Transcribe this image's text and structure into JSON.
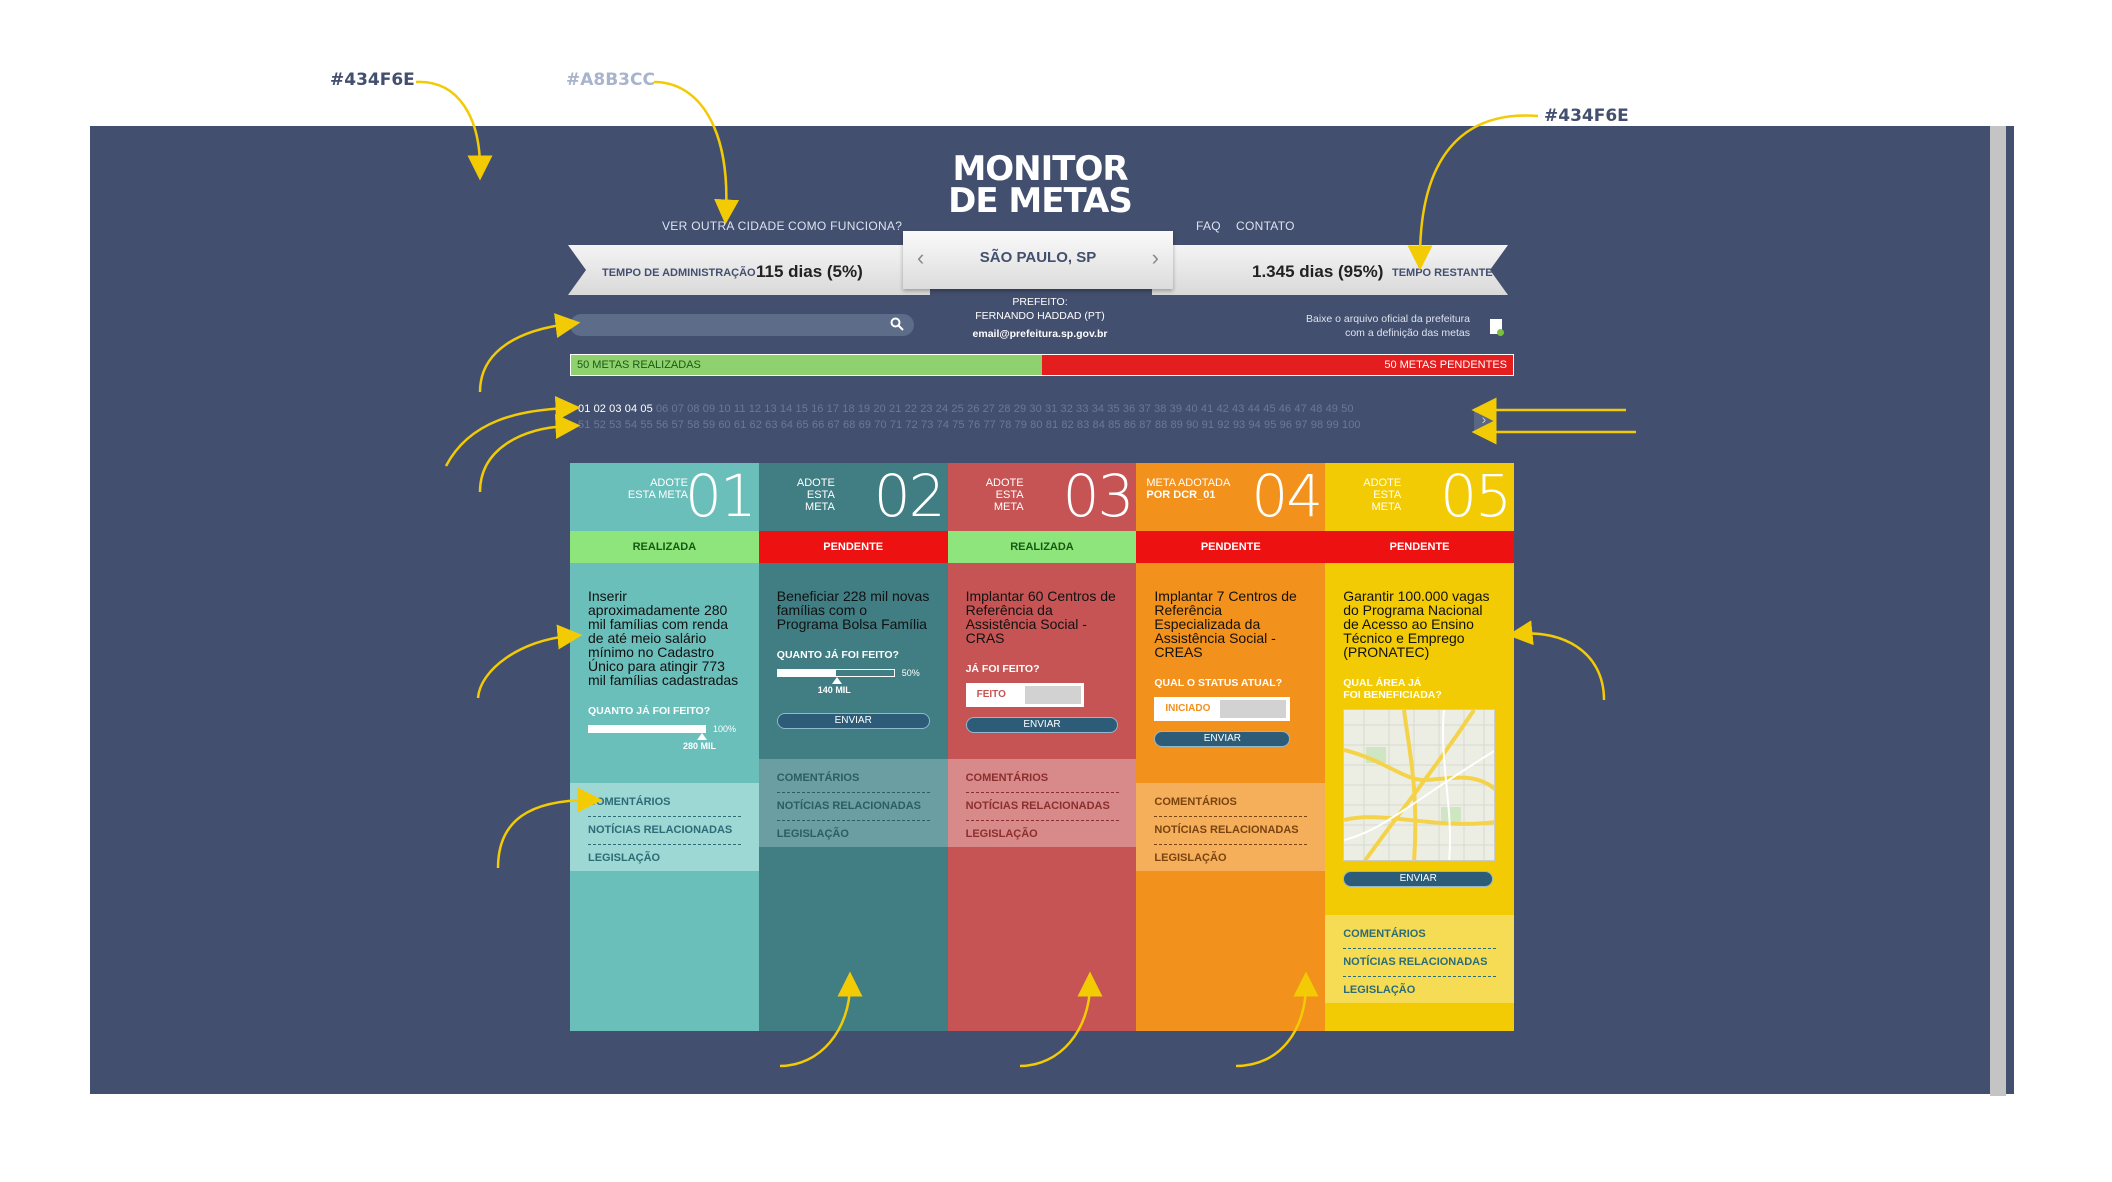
{
  "annotations": {
    "panel_bg": "#434F6E",
    "toplinks_color": "#A8B3CC",
    "ribbon_color": "#434F6E",
    "search_color": "#5C6C89",
    "nav_active": "#8B99B2",
    "nav_button": "#5A6784",
    "nav_row1": "#5A6784",
    "nav_row2": "#6A799B",
    "card1_color": "#6ABFBB",
    "links_color": "#2C6C77",
    "card5_color": "#F2CB05",
    "card2_color": "#407E84",
    "card3_color": "#C65454",
    "card4_color": "#F2911B"
  },
  "header": {
    "logo_line1": "MONITOR",
    "logo_line2": "DE METAS",
    "links_left": [
      "VER OUTRA CIDADE",
      "COMO FUNCIONA?"
    ],
    "links_right": [
      "FAQ",
      "CONTATO"
    ],
    "admin_label": "TEMPO DE ADMINISTRAÇÃO",
    "admin_value": "115 dias (5%)",
    "remaining_value": "1.345 dias (95%)",
    "remaining_label": "TEMPO RESTANTE",
    "city": "SÃO PAULO, SP",
    "mayor_label": "PREFEITO:",
    "mayor_name": "FERNANDO HADDAD (PT)",
    "mayor_email": "email@prefeitura.sp.gov.br",
    "download_line1": "Baixe o arquivo oficial da prefeitura",
    "download_line2": "com a definição das metas"
  },
  "progress": {
    "done_label": "50 METAS REALIZADAS",
    "pending_label": "50 METAS PENDENTES",
    "done_fraction": 0.5
  },
  "pagination": {
    "active": "01 02 03 04 05",
    "row1_rest": "06 07 08 09 10 11 12 13 14 15 16 17 18 19 20 21 22 23 24 25 26 27 28 29 30 31 32 33 34 35 36 37 38 39 40 41 42 43 44 45 46 47 48 49 50",
    "row2": "51 52 53 54 55 56 57 58 59 60 61 62 63 64 65 66 67 68 69 70 71 72 73 74 75 76 77 78 79 80 81 82 83 84 85 86 87 88 89 90 91 92 93 94 95 96 97 98 99 100"
  },
  "cards": [
    {
      "number": "01",
      "color": "#6ABFBB",
      "adote_line1": "ADOTE",
      "adote_line2": "ESTA META",
      "status": "REALIZADA",
      "description": "Inserir aproximadamente 280 mil famílias com renda de até meio salário mínimo no Cadastro Único para atingir 773 mil famílias cadastradas",
      "question": "QUANTO JÁ FOI FEITO?",
      "percent": "100%",
      "marker_label": "280 MIL",
      "progress_fraction": 1.0,
      "links": [
        "COMENTÁRIOS",
        "NOTÍCIAS RELACIONADAS",
        "LEGISLAÇÃO"
      ]
    },
    {
      "number": "02",
      "color": "#407E84",
      "adote_line1": "ADOTE",
      "adote_line2": "ESTA META",
      "status": "PENDENTE",
      "description": "Beneficiar 228 mil novas famílias com o Programa Bolsa Família",
      "question": "QUANTO JÁ FOI FEITO?",
      "percent": "50%",
      "marker_label": "140 MIL",
      "progress_fraction": 0.5,
      "button": "ENVIAR",
      "links": [
        "COMENTÁRIOS",
        "NOTÍCIAS RELACIONADAS",
        "LEGISLAÇÃO"
      ]
    },
    {
      "number": "03",
      "color": "#C65454",
      "adote_line1": "ADOTE",
      "adote_line2": "ESTA META",
      "status": "REALIZADA",
      "description": "Implantar 60 Centros de Referência da Assistência Social - CRAS",
      "question": "JÁ FOI FEITO?",
      "toggle": "FEITO",
      "button": "ENVIAR",
      "links": [
        "COMENTÁRIOS",
        "NOTÍCIAS RELACIONADAS",
        "LEGISLAÇÃO"
      ]
    },
    {
      "number": "04",
      "color": "#F2911B",
      "adote_line1": "META ADOTADA",
      "adote_line2": "POR DCR_01",
      "status": "PENDENTE",
      "description": "Implantar 7 Centros de Referência Especializada da Assistência Social - CREAS",
      "question": "QUAL O STATUS ATUAL?",
      "toggle": "INICIADO",
      "button": "ENVIAR",
      "links": [
        "COMENTÁRIOS",
        "NOTÍCIAS RELACIONADAS",
        "LEGISLAÇÃO"
      ]
    },
    {
      "number": "05",
      "color": "#F2CB05",
      "adote_line1": "ADOTE",
      "adote_line2": "ESTA META",
      "status": "PENDENTE",
      "description": "Garantir 100.000 vagas do Programa Nacional de Acesso ao Ensino Técnico e Emprego (PRONATEC)",
      "question_line1": "QUAL ÁREA JÁ",
      "question_line2": "FOI BENEFICIADA?",
      "button": "ENVIAR",
      "links": [
        "COMENTÁRIOS",
        "NOTÍCIAS RELACIONADAS",
        "LEGISLAÇÃO"
      ]
    }
  ]
}
